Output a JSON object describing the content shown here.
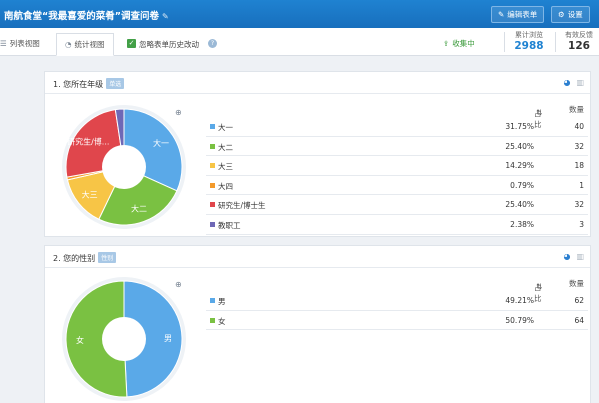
{
  "header": {
    "title": "南航食堂“我最喜爱的菜肴”调查问卷",
    "title_edit_icon": "✎",
    "edit_form_label": "编辑表单",
    "settings_label": "设置"
  },
  "toolbar": {
    "tab_list": "列表视图",
    "tab_stats": "统计视图",
    "ignore_history_label": "忽略表单历史改动",
    "collecting_label": "收集中",
    "total_views_label": "累计浏览",
    "total_views": "2988",
    "valid_responses_label": "有效反馈",
    "valid_responses": "126"
  },
  "colors": {
    "blue": "#5aa9e8",
    "green": "#7ac142",
    "yellow": "#f7c546",
    "orange": "#f39a2b",
    "red": "#e0464c",
    "purple": "#6e68b6",
    "header_blue": "#1f82d1",
    "collect_green": "#3a9a3a"
  },
  "icons": {
    "edit": "edit-icon",
    "settings": "gear-icon",
    "list_view": "list-icon",
    "stats_view": "pie-chart-icon",
    "checkbox": "check-icon",
    "help": "question-icon",
    "collecting": "collect-icon",
    "zoom": "zoom-in-icon",
    "pie_toggle": "pie-chart-icon",
    "bar_toggle": "bar-chart-icon"
  },
  "table_headers": {
    "ratio": "占比",
    "count": "数量"
  },
  "questions": [
    {
      "title": "1. 您所在年级",
      "badge": "单选",
      "options": [
        {
          "label": "大一",
          "pct": "31.75%",
          "count": "40"
        },
        {
          "label": "大二",
          "pct": "25.40%",
          "count": "32"
        },
        {
          "label": "大三",
          "pct": "14.29%",
          "count": "18"
        },
        {
          "label": "大四",
          "pct": "0.79%",
          "count": "1"
        },
        {
          "label": "研究生/博士生",
          "pct": "25.40%",
          "count": "32"
        },
        {
          "label": "教职工",
          "pct": "2.38%",
          "count": "3"
        }
      ],
      "slice_labels": [
        "大一",
        "大二",
        "大三",
        "",
        "研究生/博...",
        ""
      ]
    },
    {
      "title": "2. 您的性别",
      "badge": "性别",
      "options": [
        {
          "label": "男",
          "pct": "49.21%",
          "count": "62"
        },
        {
          "label": "女",
          "pct": "50.79%",
          "count": "64"
        }
      ],
      "slice_labels": [
        "男",
        "女"
      ]
    }
  ],
  "chart_data": [
    {
      "type": "pie",
      "categories": [
        "大一",
        "大二",
        "大三",
        "大四",
        "研究生/博士生",
        "教职工"
      ],
      "values": [
        40,
        32,
        18,
        1,
        32,
        3
      ],
      "colors": [
        "#5aa9e8",
        "#7ac142",
        "#f7c546",
        "#f39a2b",
        "#e0464c",
        "#6e68b6"
      ],
      "donut": true
    },
    {
      "type": "pie",
      "categories": [
        "男",
        "女"
      ],
      "values": [
        62,
        64
      ],
      "colors": [
        "#5aa9e8",
        "#7ac142"
      ],
      "donut": true
    }
  ]
}
